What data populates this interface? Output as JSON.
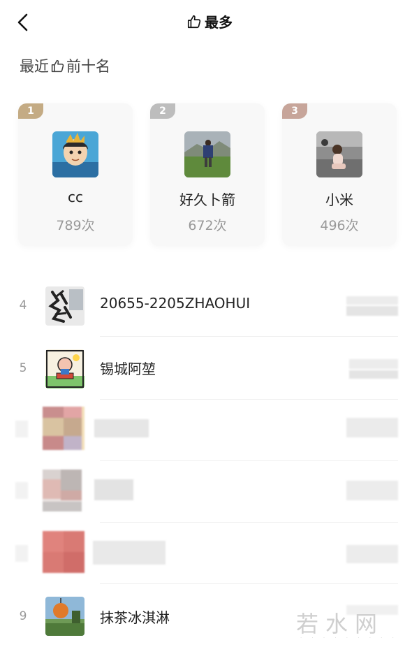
{
  "header": {
    "title": "最多"
  },
  "section": {
    "prefix": "最近",
    "suffix": "前十名"
  },
  "top3": [
    {
      "rank": "1",
      "name": "cc",
      "count": "789次",
      "tag_color": "#c4ab84"
    },
    {
      "rank": "2",
      "name": "好久卜箭",
      "count": "672次",
      "tag_color": "#bdbdbd"
    },
    {
      "rank": "3",
      "name": "小米",
      "count": "496次",
      "tag_color": "#c7a59a"
    }
  ],
  "list": [
    {
      "rank": "4",
      "name": "20655-2205ZHAOHUI"
    },
    {
      "rank": "5",
      "name": "锡城阿堃"
    },
    {
      "rank": "",
      "name": ""
    },
    {
      "rank": "",
      "name": ""
    },
    {
      "rank": "",
      "name": ""
    },
    {
      "rank": "9",
      "name": "抹茶冰淇淋"
    }
  ],
  "watermark": "若水网"
}
